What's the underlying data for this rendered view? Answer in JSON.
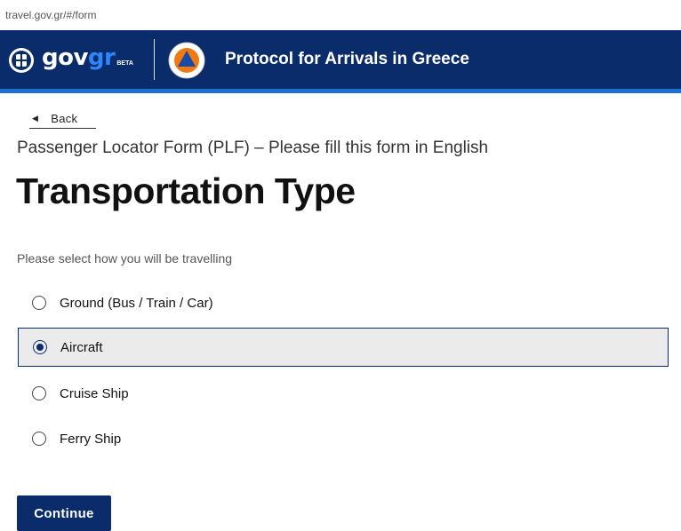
{
  "browser": {
    "url": "travel.gov.gr/#/form"
  },
  "header": {
    "brand_gov": "gov",
    "brand_gr": "gr",
    "brand_beta": "BETA",
    "title": "Protocol for Arrivals in Greece",
    "colors": {
      "background": "#0b2c6b",
      "accent_bar": "#1d6fd1",
      "brand_gr": "#2e86ff"
    },
    "icons": [
      "greek-emblem-icon",
      "civil-protection-logo"
    ]
  },
  "nav": {
    "back_label": "Back",
    "back_icon": "triangle-left-icon"
  },
  "form": {
    "subtitle": "Passenger Locator Form (PLF) – Please fill this form in English",
    "title": "Transportation Type",
    "hint": "Please select how you will be travelling",
    "options": [
      {
        "label": "Ground (Bus / Train / Car)",
        "selected": false
      },
      {
        "label": "Aircraft",
        "selected": true
      },
      {
        "label": "Cruise Ship",
        "selected": false
      },
      {
        "label": "Ferry Ship",
        "selected": false
      }
    ],
    "continue_label": "Continue",
    "colors": {
      "primary": "#0b2c6b",
      "selected_bg": "#ebebeb"
    }
  }
}
